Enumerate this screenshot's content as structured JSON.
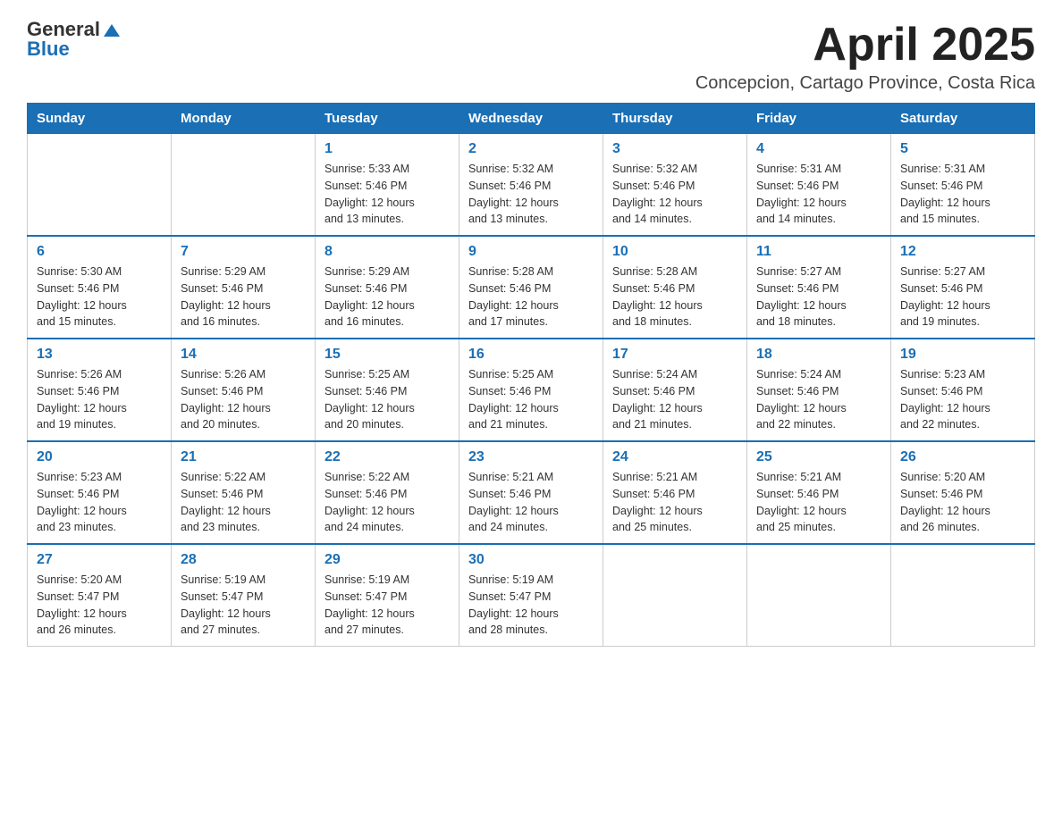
{
  "logo": {
    "text_general": "General",
    "text_blue": "Blue",
    "arrow": "▲"
  },
  "title": "April 2025",
  "subtitle": "Concepcion, Cartago Province, Costa Rica",
  "weekdays": [
    "Sunday",
    "Monday",
    "Tuesday",
    "Wednesday",
    "Thursday",
    "Friday",
    "Saturday"
  ],
  "weeks": [
    [
      {
        "day": "",
        "info": ""
      },
      {
        "day": "",
        "info": ""
      },
      {
        "day": "1",
        "info": "Sunrise: 5:33 AM\nSunset: 5:46 PM\nDaylight: 12 hours\nand 13 minutes."
      },
      {
        "day": "2",
        "info": "Sunrise: 5:32 AM\nSunset: 5:46 PM\nDaylight: 12 hours\nand 13 minutes."
      },
      {
        "day": "3",
        "info": "Sunrise: 5:32 AM\nSunset: 5:46 PM\nDaylight: 12 hours\nand 14 minutes."
      },
      {
        "day": "4",
        "info": "Sunrise: 5:31 AM\nSunset: 5:46 PM\nDaylight: 12 hours\nand 14 minutes."
      },
      {
        "day": "5",
        "info": "Sunrise: 5:31 AM\nSunset: 5:46 PM\nDaylight: 12 hours\nand 15 minutes."
      }
    ],
    [
      {
        "day": "6",
        "info": "Sunrise: 5:30 AM\nSunset: 5:46 PM\nDaylight: 12 hours\nand 15 minutes."
      },
      {
        "day": "7",
        "info": "Sunrise: 5:29 AM\nSunset: 5:46 PM\nDaylight: 12 hours\nand 16 minutes."
      },
      {
        "day": "8",
        "info": "Sunrise: 5:29 AM\nSunset: 5:46 PM\nDaylight: 12 hours\nand 16 minutes."
      },
      {
        "day": "9",
        "info": "Sunrise: 5:28 AM\nSunset: 5:46 PM\nDaylight: 12 hours\nand 17 minutes."
      },
      {
        "day": "10",
        "info": "Sunrise: 5:28 AM\nSunset: 5:46 PM\nDaylight: 12 hours\nand 18 minutes."
      },
      {
        "day": "11",
        "info": "Sunrise: 5:27 AM\nSunset: 5:46 PM\nDaylight: 12 hours\nand 18 minutes."
      },
      {
        "day": "12",
        "info": "Sunrise: 5:27 AM\nSunset: 5:46 PM\nDaylight: 12 hours\nand 19 minutes."
      }
    ],
    [
      {
        "day": "13",
        "info": "Sunrise: 5:26 AM\nSunset: 5:46 PM\nDaylight: 12 hours\nand 19 minutes."
      },
      {
        "day": "14",
        "info": "Sunrise: 5:26 AM\nSunset: 5:46 PM\nDaylight: 12 hours\nand 20 minutes."
      },
      {
        "day": "15",
        "info": "Sunrise: 5:25 AM\nSunset: 5:46 PM\nDaylight: 12 hours\nand 20 minutes."
      },
      {
        "day": "16",
        "info": "Sunrise: 5:25 AM\nSunset: 5:46 PM\nDaylight: 12 hours\nand 21 minutes."
      },
      {
        "day": "17",
        "info": "Sunrise: 5:24 AM\nSunset: 5:46 PM\nDaylight: 12 hours\nand 21 minutes."
      },
      {
        "day": "18",
        "info": "Sunrise: 5:24 AM\nSunset: 5:46 PM\nDaylight: 12 hours\nand 22 minutes."
      },
      {
        "day": "19",
        "info": "Sunrise: 5:23 AM\nSunset: 5:46 PM\nDaylight: 12 hours\nand 22 minutes."
      }
    ],
    [
      {
        "day": "20",
        "info": "Sunrise: 5:23 AM\nSunset: 5:46 PM\nDaylight: 12 hours\nand 23 minutes."
      },
      {
        "day": "21",
        "info": "Sunrise: 5:22 AM\nSunset: 5:46 PM\nDaylight: 12 hours\nand 23 minutes."
      },
      {
        "day": "22",
        "info": "Sunrise: 5:22 AM\nSunset: 5:46 PM\nDaylight: 12 hours\nand 24 minutes."
      },
      {
        "day": "23",
        "info": "Sunrise: 5:21 AM\nSunset: 5:46 PM\nDaylight: 12 hours\nand 24 minutes."
      },
      {
        "day": "24",
        "info": "Sunrise: 5:21 AM\nSunset: 5:46 PM\nDaylight: 12 hours\nand 25 minutes."
      },
      {
        "day": "25",
        "info": "Sunrise: 5:21 AM\nSunset: 5:46 PM\nDaylight: 12 hours\nand 25 minutes."
      },
      {
        "day": "26",
        "info": "Sunrise: 5:20 AM\nSunset: 5:46 PM\nDaylight: 12 hours\nand 26 minutes."
      }
    ],
    [
      {
        "day": "27",
        "info": "Sunrise: 5:20 AM\nSunset: 5:47 PM\nDaylight: 12 hours\nand 26 minutes."
      },
      {
        "day": "28",
        "info": "Sunrise: 5:19 AM\nSunset: 5:47 PM\nDaylight: 12 hours\nand 27 minutes."
      },
      {
        "day": "29",
        "info": "Sunrise: 5:19 AM\nSunset: 5:47 PM\nDaylight: 12 hours\nand 27 minutes."
      },
      {
        "day": "30",
        "info": "Sunrise: 5:19 AM\nSunset: 5:47 PM\nDaylight: 12 hours\nand 28 minutes."
      },
      {
        "day": "",
        "info": ""
      },
      {
        "day": "",
        "info": ""
      },
      {
        "day": "",
        "info": ""
      }
    ]
  ]
}
